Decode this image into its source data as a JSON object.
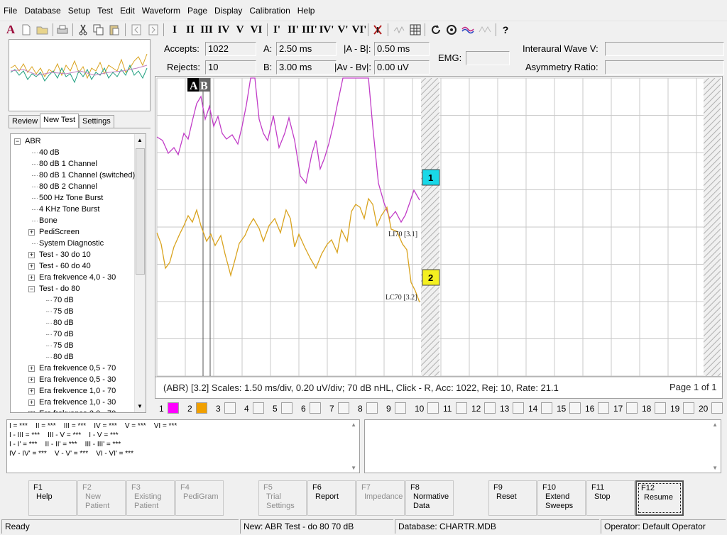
{
  "menu": [
    "File",
    "Database",
    "Setup",
    "Test",
    "Edit",
    "Waveform",
    "Page",
    "Display",
    "Calibration",
    "Help"
  ],
  "toolbar": {
    "wave_buttons": [
      "I",
      "II",
      "III",
      "IV",
      "V",
      "VI",
      "I'",
      "II'",
      "III'",
      "IV'",
      "V'",
      "VI'"
    ]
  },
  "stats": {
    "accepts_label": "Accepts:",
    "accepts_value": "1022",
    "rejects_label": "Rejects:",
    "rejects_value": "10",
    "a_label": "A:",
    "a_value": "2.50 ms",
    "b_label": "B:",
    "b_value": "3.00 ms",
    "ab_label": "|A - B|:",
    "ab_value": "0.50 ms",
    "avbv_label": "|Av - Bv|:",
    "avbv_value": "0.00 uV",
    "emg_label": "EMG:",
    "emg_value": "",
    "interaural_label": "Interaural Wave V:",
    "interaural_value": "",
    "asym_label": "Asymmetry Ratio:",
    "asym_value": ""
  },
  "tabs": [
    "Review",
    "New Test",
    "Settings"
  ],
  "tree": [
    {
      "label": "ABR",
      "level": 0,
      "exp": "-"
    },
    {
      "label": "40 dB",
      "level": 1
    },
    {
      "label": "80 dB 1 Channel",
      "level": 1
    },
    {
      "label": "80 dB 1 Channel (switched)",
      "level": 1
    },
    {
      "label": "80 dB 2 Channel",
      "level": 1
    },
    {
      "label": "500 Hz Tone Burst",
      "level": 1
    },
    {
      "label": "4 KHz Tone Burst",
      "level": 1
    },
    {
      "label": "Bone",
      "level": 1
    },
    {
      "label": "PediScreen",
      "level": 1,
      "exp": "+"
    },
    {
      "label": "System Diagnostic",
      "level": 1
    },
    {
      "label": "Test - 30 do 10",
      "level": 1,
      "exp": "+"
    },
    {
      "label": "Test - 60 do 40",
      "level": 1,
      "exp": "+"
    },
    {
      "label": "Era frekvence 4,0 - 30",
      "level": 1,
      "exp": "+"
    },
    {
      "label": "Test - do 80",
      "level": 1,
      "exp": "-"
    },
    {
      "label": "70 dB",
      "level": 2
    },
    {
      "label": "75 dB",
      "level": 2
    },
    {
      "label": "80 dB",
      "level": 2
    },
    {
      "label": "70 dB",
      "level": 2
    },
    {
      "label": "75 dB",
      "level": 2
    },
    {
      "label": "80 dB",
      "level": 2
    },
    {
      "label": "Era frekvence 0,5 - 70",
      "level": 1,
      "exp": "+"
    },
    {
      "label": "Era frekvence 0,5 - 30",
      "level": 1,
      "exp": "+"
    },
    {
      "label": "Era frekvence 1,0 - 70",
      "level": 1,
      "exp": "+"
    },
    {
      "label": "Era frekvence 1,0 - 30",
      "level": 1,
      "exp": "+"
    },
    {
      "label": "Era frekvence 2,0 - 70",
      "level": 1,
      "exp": "+"
    }
  ],
  "plot": {
    "cursor_a": "A",
    "cursor_b": "B",
    "marker1": "1",
    "marker2": "2",
    "label1": "LI70 [3.1]",
    "label2": "LC70 [3.2]",
    "trace1_color": "#c13cc7",
    "trace2_color": "#d9a31e"
  },
  "scale_info": "(ABR) [3.2]  Scales: 1.50 ms/div,  0.20 uV/div;  70 dB nHL,  Click - R,  Acc: 1022,  Rej: 10,  Rate: 21.1",
  "page_info": "Page 1 of 1",
  "channels": [
    "1",
    "2",
    "3",
    "4",
    "5",
    "6",
    "7",
    "8",
    "9",
    "10",
    "11",
    "12",
    "13",
    "14",
    "15",
    "16",
    "17",
    "18",
    "19",
    "20"
  ],
  "channel_colors": {
    "1": "#ff00ff",
    "2": "#f0a000"
  },
  "latency_lines": [
    "I = ***    II = ***    III = ***    IV = ***    V = ***    VI = ***",
    "I - III = ***    III - V = ***    I - V = ***",
    "I - I' = ***    II - II' = ***    III - III' = ***",
    "IV - IV' = ***    V - V' = ***    VI - VI' = ***"
  ],
  "fkeys": [
    {
      "key": "F1",
      "label": "Help",
      "enabled": true
    },
    {
      "key": "F2",
      "label": "New\nPatient",
      "enabled": false
    },
    {
      "key": "F3",
      "label": "Existing\nPatient",
      "enabled": false
    },
    {
      "key": "F4",
      "label": "PediGram",
      "enabled": false
    },
    {
      "key": "F5",
      "label": "Trial\nSettings",
      "enabled": false
    },
    {
      "key": "F6",
      "label": "Report",
      "enabled": true
    },
    {
      "key": "F7",
      "label": "Impedance",
      "enabled": false
    },
    {
      "key": "F8",
      "label": "Normative\nData",
      "enabled": true
    },
    {
      "key": "F9",
      "label": "Reset",
      "enabled": true
    },
    {
      "key": "F10",
      "label": "Extend\nSweeps",
      "enabled": true
    },
    {
      "key": "F11",
      "label": "Stop",
      "enabled": true
    },
    {
      "key": "F12",
      "label": "Resume",
      "enabled": true
    }
  ],
  "status": {
    "state": "Ready",
    "test": "New: ABR Test - do 80 70 dB",
    "database": "Database: CHARTR.MDB",
    "operator": "Operator: Default Operator"
  }
}
